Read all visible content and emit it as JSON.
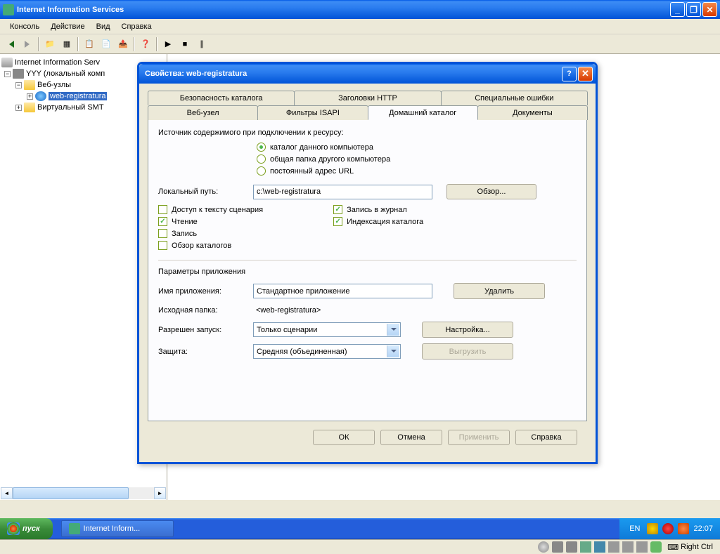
{
  "mainWindow": {
    "title": "Internet Information Services"
  },
  "menu": {
    "console": "Консоль",
    "action": "Действие",
    "view": "Вид",
    "help": "Справка"
  },
  "tree": {
    "root": "Internet Information Serv",
    "node1": "YYY (локальный комп",
    "node2": "Веб-узлы",
    "node3": "web-registratura",
    "node4": "Виртуальный SMT"
  },
  "dialog": {
    "title": "Свойства: web-registratura",
    "tabs": {
      "security": "Безопасность каталога",
      "headers": "Заголовки HTTP",
      "errors": "Специальные ошибки",
      "website": "Веб-узел",
      "isapi": "Фильтры ISAPI",
      "home": "Домашний каталог",
      "documents": "Документы"
    },
    "sourceLabel": "Источник содержимого при подключении к ресурсу:",
    "radio": {
      "local": "каталог данного компьютера",
      "share": "общая папка другого компьютера",
      "url": "постоянный адрес URL"
    },
    "pathLabel": "Локальный путь:",
    "pathValue": "c:\\web-registratura",
    "browseBtn": "Обзор...",
    "checks": {
      "script": "Доступ к тексту сценария",
      "read": "Чтение",
      "write": "Запись",
      "browse": "Обзор каталогов",
      "log": "Запись в журнал",
      "index": "Индексация каталога"
    },
    "appSection": "Параметры приложения",
    "appName": {
      "label": "Имя приложения:",
      "value": "Стандартное приложение"
    },
    "startPoint": {
      "label": "Исходная папка:",
      "value": "<web-registratura>"
    },
    "execPerm": {
      "label": "Разрешен запуск:",
      "value": "Только сценарии"
    },
    "protection": {
      "label": "Защита:",
      "value": "Средняя (объединенная)"
    },
    "buttons": {
      "remove": "Удалить",
      "config": "Настройка...",
      "unload": "Выгрузить",
      "ok": "ОК",
      "cancel": "Отмена",
      "apply": "Применить",
      "help": "Справка"
    }
  },
  "taskbar": {
    "start": "пуск",
    "task1": "Internet Inform...",
    "lang": "EN",
    "time": "22:07"
  },
  "vmbar": {
    "rightCtrl": "Right Ctrl"
  }
}
